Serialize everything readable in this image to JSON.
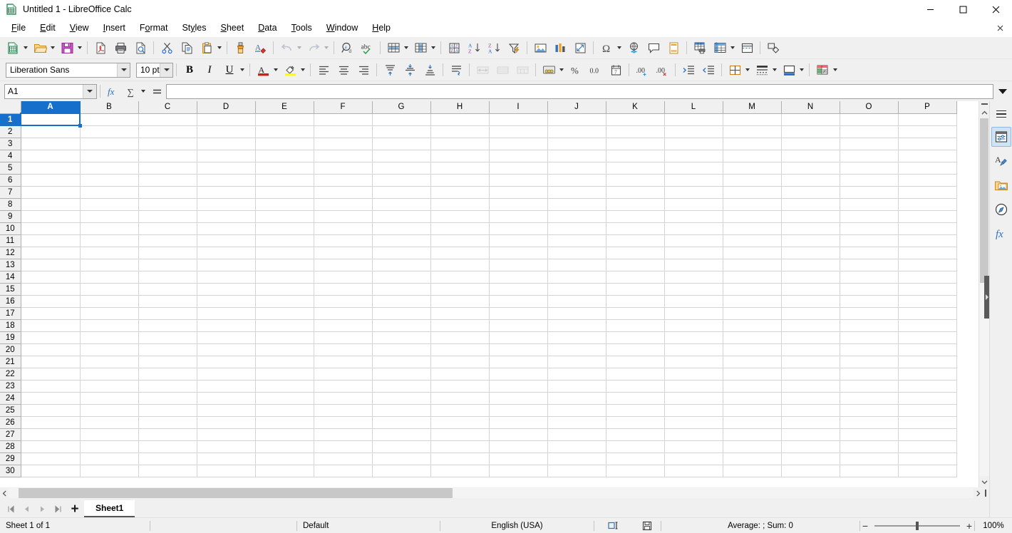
{
  "window": {
    "title": "Untitled 1 - LibreOffice Calc",
    "app_icon": "calc-document-icon",
    "minimize": "—",
    "maximize": "☐",
    "close": "✕",
    "doc_close": "✕"
  },
  "menubar": {
    "items": [
      {
        "label": "File",
        "key": "F"
      },
      {
        "label": "Edit",
        "key": "E"
      },
      {
        "label": "View",
        "key": "V"
      },
      {
        "label": "Insert",
        "key": "I"
      },
      {
        "label": "Format",
        "key": "o"
      },
      {
        "label": "Styles",
        "key": "y"
      },
      {
        "label": "Sheet",
        "key": "S"
      },
      {
        "label": "Data",
        "key": "D"
      },
      {
        "label": "Tools",
        "key": "T"
      },
      {
        "label": "Window",
        "key": "W"
      },
      {
        "label": "Help",
        "key": "H"
      }
    ]
  },
  "standard_toolbar": {
    "items": [
      {
        "name": "new-document",
        "tooltip": "New",
        "dropdown": true
      },
      {
        "name": "open-file",
        "tooltip": "Open",
        "dropdown": true
      },
      {
        "name": "save",
        "tooltip": "Save",
        "dropdown": true
      },
      {
        "name": "export-pdf",
        "tooltip": "Export as PDF"
      },
      {
        "name": "print",
        "tooltip": "Print"
      },
      {
        "name": "print-preview",
        "tooltip": "Toggle Print Preview"
      },
      {
        "name": "cut",
        "tooltip": "Cut"
      },
      {
        "name": "copy",
        "tooltip": "Copy"
      },
      {
        "name": "paste",
        "tooltip": "Paste",
        "dropdown": true
      },
      {
        "name": "clone-formatting",
        "tooltip": "Clone Formatting"
      },
      {
        "name": "clear-formatting",
        "tooltip": "Clear Direct Formatting"
      },
      {
        "name": "undo",
        "tooltip": "Undo",
        "dropdown": true,
        "disabled": true
      },
      {
        "name": "redo",
        "tooltip": "Redo",
        "dropdown": true,
        "disabled": true
      },
      {
        "name": "find-and-replace",
        "tooltip": "Find and Replace"
      },
      {
        "name": "spelling",
        "tooltip": "Spelling"
      },
      {
        "name": "row",
        "tooltip": "Row",
        "dropdown": true
      },
      {
        "name": "column",
        "tooltip": "Column",
        "dropdown": true
      },
      {
        "name": "sort",
        "tooltip": "Sort"
      },
      {
        "name": "sort-ascending",
        "tooltip": "Sort Ascending"
      },
      {
        "name": "sort-descending",
        "tooltip": "Sort Descending"
      },
      {
        "name": "autofilter",
        "tooltip": "AutoFilter"
      },
      {
        "name": "insert-image",
        "tooltip": "Insert Image"
      },
      {
        "name": "insert-chart",
        "tooltip": "Insert Chart"
      },
      {
        "name": "pivot-table",
        "tooltip": "Insert or Edit Pivot Table"
      },
      {
        "name": "special-character",
        "tooltip": "Insert Special Character",
        "dropdown": true
      },
      {
        "name": "insert-hyperlink",
        "tooltip": "Insert Hyperlink"
      },
      {
        "name": "insert-comment",
        "tooltip": "Insert Comment"
      },
      {
        "name": "headers-and-footers",
        "tooltip": "Headers and Footers"
      },
      {
        "name": "define-print-area",
        "tooltip": "Define Print Area"
      },
      {
        "name": "freeze-rows-and-columns",
        "tooltip": "Freeze Rows and Columns",
        "dropdown": true
      },
      {
        "name": "split-window",
        "tooltip": "Split Window"
      },
      {
        "name": "show-draw-functions",
        "tooltip": "Show Draw Functions"
      }
    ]
  },
  "formatting_toolbar": {
    "font_name": "Liberation Sans",
    "font_size": "10 pt",
    "bold_label": "B",
    "italic_label": "I",
    "underline_label": "U",
    "items": [
      {
        "name": "bold"
      },
      {
        "name": "italic"
      },
      {
        "name": "underline",
        "dropdown": true
      },
      {
        "name": "font-color",
        "dropdown": true,
        "color": "#c9211e"
      },
      {
        "name": "background-color",
        "dropdown": true,
        "color": "#ffff00"
      },
      {
        "name": "align-left"
      },
      {
        "name": "align-center"
      },
      {
        "name": "align-right"
      },
      {
        "name": "align-top"
      },
      {
        "name": "center-vertically"
      },
      {
        "name": "align-bottom"
      },
      {
        "name": "wrap-text"
      },
      {
        "name": "merge-and-center-cells",
        "disabled": true
      },
      {
        "name": "merge-cells",
        "disabled": true
      },
      {
        "name": "unmerge-cells",
        "disabled": true
      },
      {
        "name": "format-as-currency",
        "dropdown": true
      },
      {
        "name": "format-as-percent"
      },
      {
        "name": "format-as-number"
      },
      {
        "name": "format-as-date"
      },
      {
        "name": "add-decimal-place"
      },
      {
        "name": "delete-decimal-place"
      },
      {
        "name": "increase-indent"
      },
      {
        "name": "decrease-indent"
      },
      {
        "name": "borders",
        "dropdown": true
      },
      {
        "name": "border-style",
        "dropdown": true
      },
      {
        "name": "border-color",
        "dropdown": true
      },
      {
        "name": "conditional-formatting",
        "dropdown": true
      }
    ]
  },
  "formula_bar": {
    "name_box_value": "A1",
    "function_wizard_icon": "fx",
    "sum_icon": "∑",
    "formula_icon": "=",
    "input_value": "",
    "input_placeholder": "",
    "expand_icon": "chevron-down-icon"
  },
  "grid": {
    "columns": [
      "A",
      "B",
      "C",
      "D",
      "E",
      "F",
      "G",
      "H",
      "I",
      "J",
      "K",
      "L",
      "M",
      "N",
      "O",
      "P"
    ],
    "selected_column": "A",
    "rows": [
      1,
      2,
      3,
      4,
      5,
      6,
      7,
      8,
      9,
      10,
      11,
      12,
      13,
      14,
      15,
      16,
      17,
      18,
      19,
      20,
      21,
      22,
      23,
      24,
      25,
      26,
      27,
      28,
      29,
      30
    ],
    "selected_row": 1,
    "active_cell": "A1",
    "cell_values": {}
  },
  "sheet_tabs": {
    "first_label": "⏮",
    "prev_label": "◀",
    "next_label": "▶",
    "last_label": "⏭",
    "add_label": "+",
    "tabs": [
      {
        "label": "Sheet1",
        "active": true
      }
    ]
  },
  "sidebar": {
    "menu_icon": "hamburger-icon",
    "items": [
      {
        "name": "properties",
        "label": "Properties",
        "selected": true
      },
      {
        "name": "styles",
        "label": "Styles",
        "selected": false
      },
      {
        "name": "gallery",
        "label": "Gallery",
        "selected": false
      },
      {
        "name": "navigator",
        "label": "Navigator",
        "selected": false
      },
      {
        "name": "functions",
        "label": "Functions",
        "selected": false
      }
    ]
  },
  "status_bar": {
    "sheet_info": "Sheet 1 of 1",
    "page_style_blank": "",
    "page_style": "Default",
    "language": "English (USA)",
    "insert_mode_icon": "overwrite-mode-icon",
    "selection_mode": "",
    "save_status_icon": "document-modified-icon",
    "summary": "Average: ; Sum: 0",
    "zoom_minus": "−",
    "zoom_plus": "+",
    "zoom_level": "100%"
  },
  "colors": {
    "accent": "#1670cb",
    "toolbar_bg": "#f0f0f0",
    "grid_line": "#d4d4d4",
    "header_bg": "#f0f0f0"
  }
}
